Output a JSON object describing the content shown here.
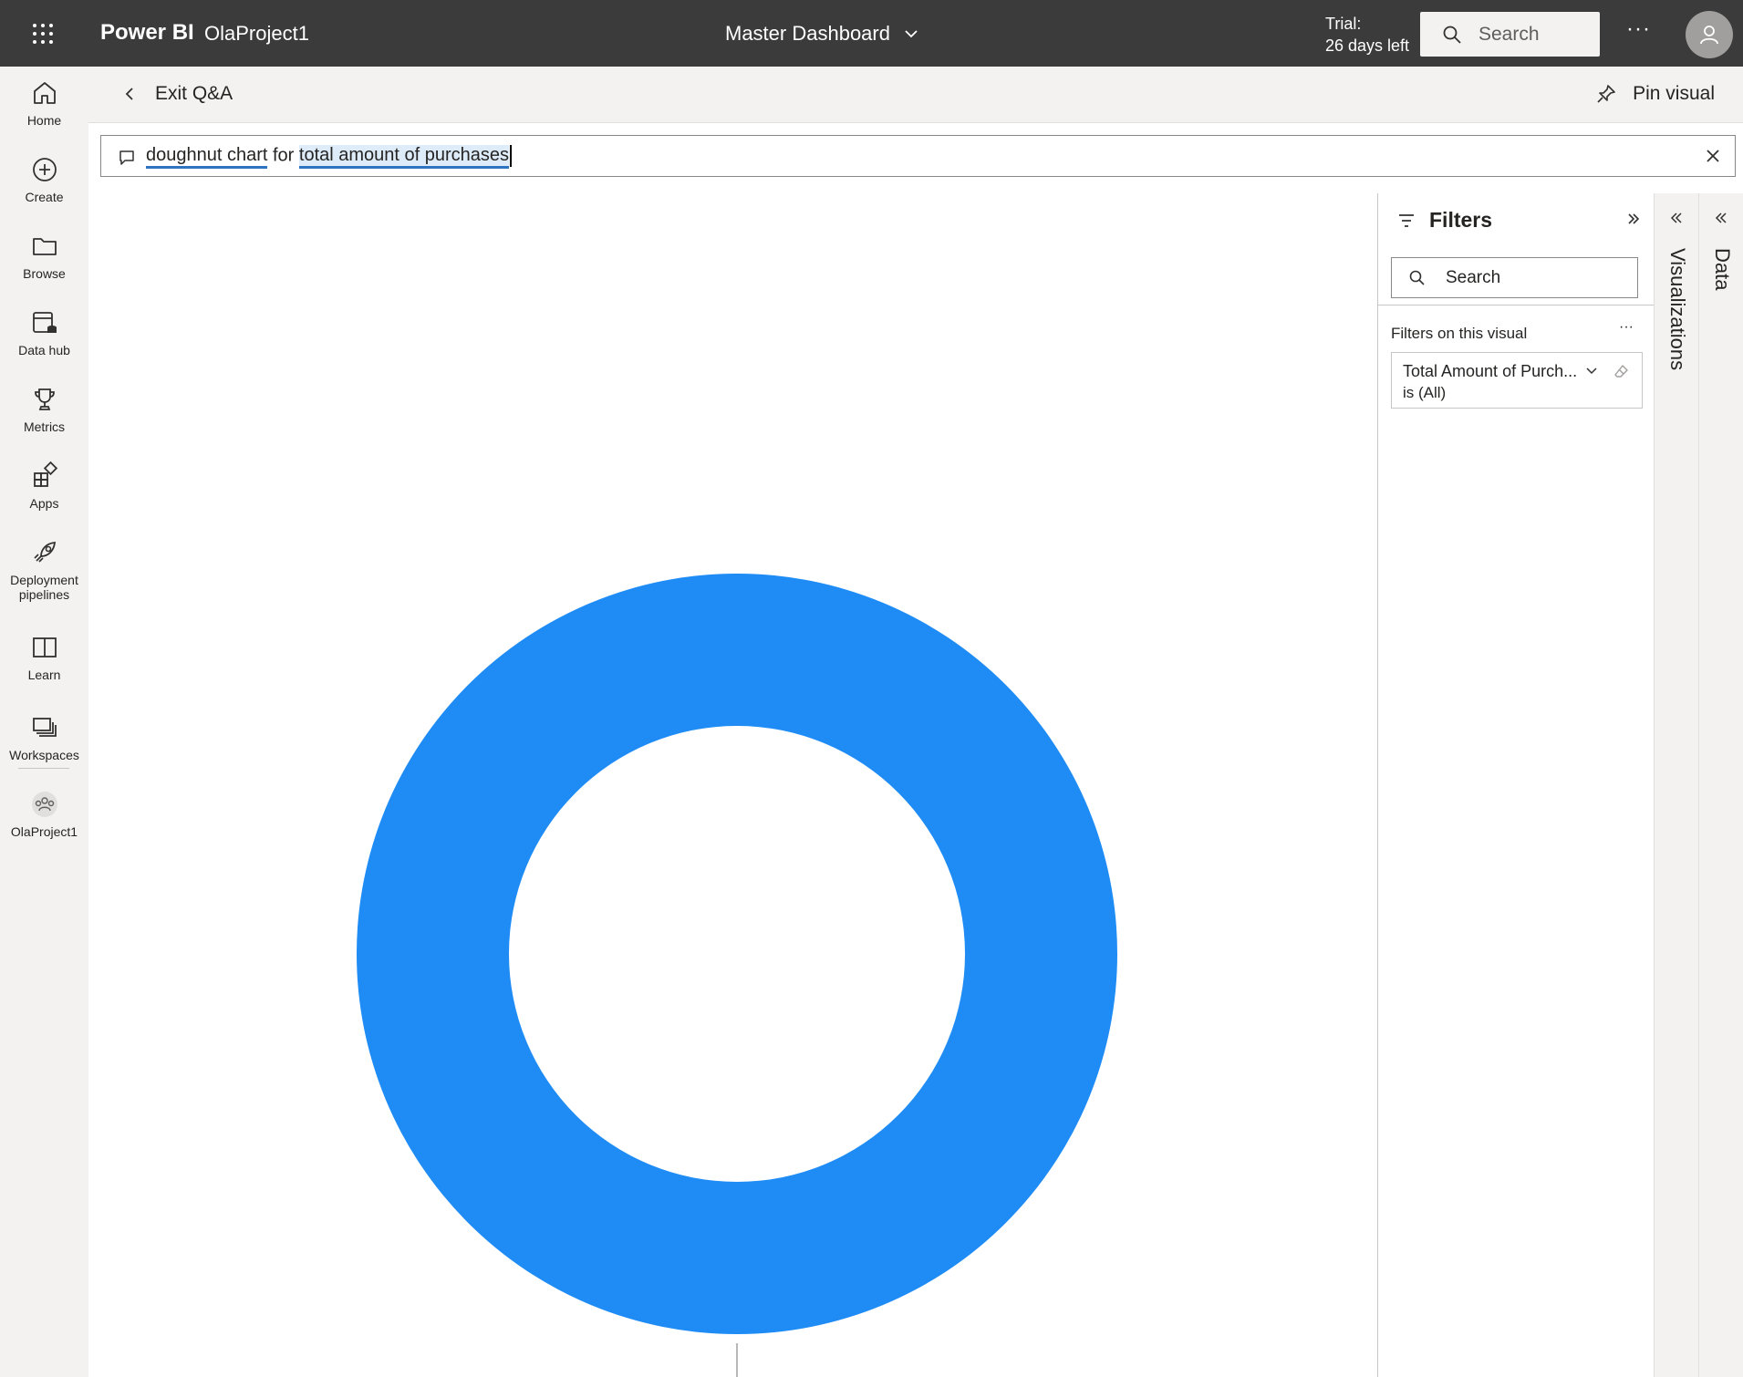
{
  "topbar": {
    "brand": "Power BI",
    "workspace": "OlaProject1",
    "report_title": "Master Dashboard",
    "trial_line1": "Trial:",
    "trial_line2": "26 days left",
    "search_placeholder": "Search",
    "more": "···"
  },
  "nav": {
    "items": [
      {
        "label": "Home",
        "icon": "home-icon"
      },
      {
        "label": "Create",
        "icon": "plus-circle-icon"
      },
      {
        "label": "Browse",
        "icon": "folder-icon"
      },
      {
        "label": "Data hub",
        "icon": "data-hub-icon"
      },
      {
        "label": "Metrics",
        "icon": "trophy-icon"
      },
      {
        "label": "Apps",
        "icon": "apps-icon"
      },
      {
        "label": "Deployment pipelines",
        "icon": "rocket-icon"
      },
      {
        "label": "Learn",
        "icon": "book-icon"
      },
      {
        "label": "Workspaces",
        "icon": "workspaces-icon"
      },
      {
        "label": "OlaProject1",
        "icon": "workspace-group-icon"
      }
    ]
  },
  "header": {
    "exit_label": "Exit Q&A",
    "pin_label": "Pin visual"
  },
  "qa": {
    "part1": "doughnut chart",
    "part2": " for ",
    "part3": "total amount of purchases"
  },
  "filters": {
    "title": "Filters",
    "search_placeholder": "Search",
    "section_label": "Filters on this visual",
    "section_more": "···",
    "card_title": "Total Amount of Purch...",
    "card_value": "is (All)"
  },
  "panes": {
    "visualizations": "Visualizations",
    "data": "Data"
  },
  "colors": {
    "topbar": "#3b3b3b",
    "accent": "#1f8cf6",
    "nav_bg": "#f3f2f1"
  },
  "chart_data": {
    "type": "pie",
    "variant": "doughnut",
    "title": "",
    "slices": [
      {
        "label": "",
        "value": 100,
        "color": "#1f8cf6"
      }
    ]
  }
}
